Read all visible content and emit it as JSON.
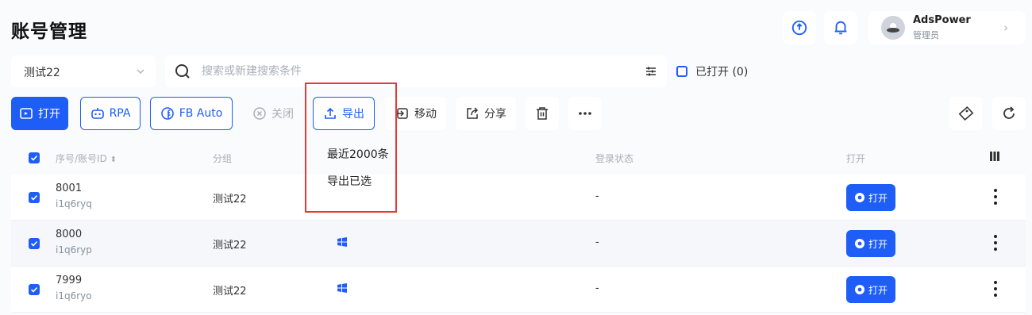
{
  "page": {
    "title": "账号管理"
  },
  "user": {
    "name": "AdsPower",
    "role": "管理员"
  },
  "filters": {
    "group_value": "测试22",
    "search_placeholder": "搜索或新建搜索条件",
    "opened_label": "已打开 (0)"
  },
  "toolbar": {
    "open": "打开",
    "rpa": "RPA",
    "fb_auto": "FB Auto",
    "close": "关闭",
    "export": "导出",
    "move": "移动",
    "share": "分享"
  },
  "export_menu": [
    "最近2000条",
    "导出已选"
  ],
  "table": {
    "headers": {
      "id": "序号/账号ID",
      "group": "分组",
      "login": "登录状态",
      "open": "打开"
    },
    "rows": [
      {
        "index": "8001",
        "account_id": "i1q6ryq",
        "group": "测试22",
        "login": "-",
        "open_label": "打开"
      },
      {
        "index": "8000",
        "account_id": "i1q6ryp",
        "group": "测试22",
        "login": "-",
        "open_label": "打开"
      },
      {
        "index": "7999",
        "account_id": "i1q6ryo",
        "group": "测试22",
        "login": "-",
        "open_label": "打开"
      }
    ]
  },
  "colors": {
    "accent": "#1e5df6",
    "highlight": "#e53935"
  },
  "icons": [
    "sync-icon",
    "bell-icon",
    "avatar",
    "chevron-right-icon",
    "chevron-down-icon",
    "search-icon",
    "filter-icon",
    "window-icon",
    "robot-icon",
    "facebook-icon",
    "close-circle-icon",
    "upload-icon",
    "move-icon",
    "share-icon",
    "trash-icon",
    "more-icon",
    "tag-icon",
    "refresh-icon",
    "sort-icon",
    "columns-icon",
    "windows-icon",
    "chrome-icon"
  ]
}
